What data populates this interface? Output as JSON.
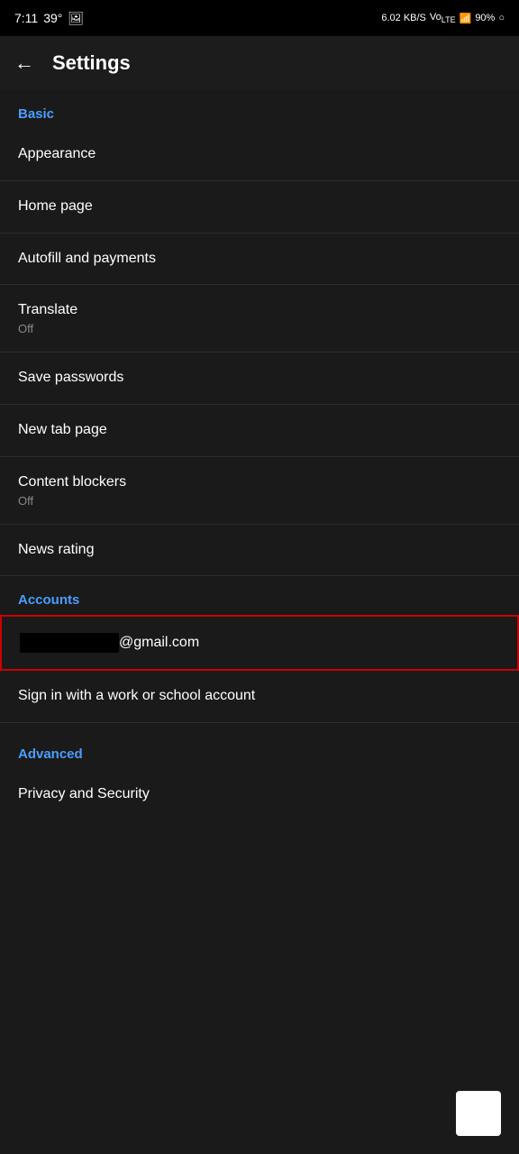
{
  "status_bar": {
    "time": "7:11",
    "signal_info": "39°",
    "data_speed": "6.02 KB/S",
    "network": "VoLTE 4G",
    "battery": "90%"
  },
  "header": {
    "back_label": "←",
    "title": "Settings"
  },
  "sections": {
    "basic": {
      "label": "Basic",
      "items": [
        {
          "title": "Appearance",
          "subtitle": ""
        },
        {
          "title": "Home page",
          "subtitle": ""
        },
        {
          "title": "Autofill and payments",
          "subtitle": ""
        },
        {
          "title": "Translate",
          "subtitle": "Off"
        },
        {
          "title": "Save passwords",
          "subtitle": ""
        },
        {
          "title": "New tab page",
          "subtitle": ""
        },
        {
          "title": "Content blockers",
          "subtitle": "Off"
        },
        {
          "title": "News rating",
          "subtitle": ""
        }
      ]
    },
    "accounts": {
      "label": "Accounts",
      "email_suffix": "@gmail.com",
      "work_account_label": "Sign in with a work or school account"
    },
    "advanced": {
      "label": "Advanced",
      "items": [
        {
          "title": "Privacy and Security",
          "subtitle": ""
        }
      ]
    }
  }
}
